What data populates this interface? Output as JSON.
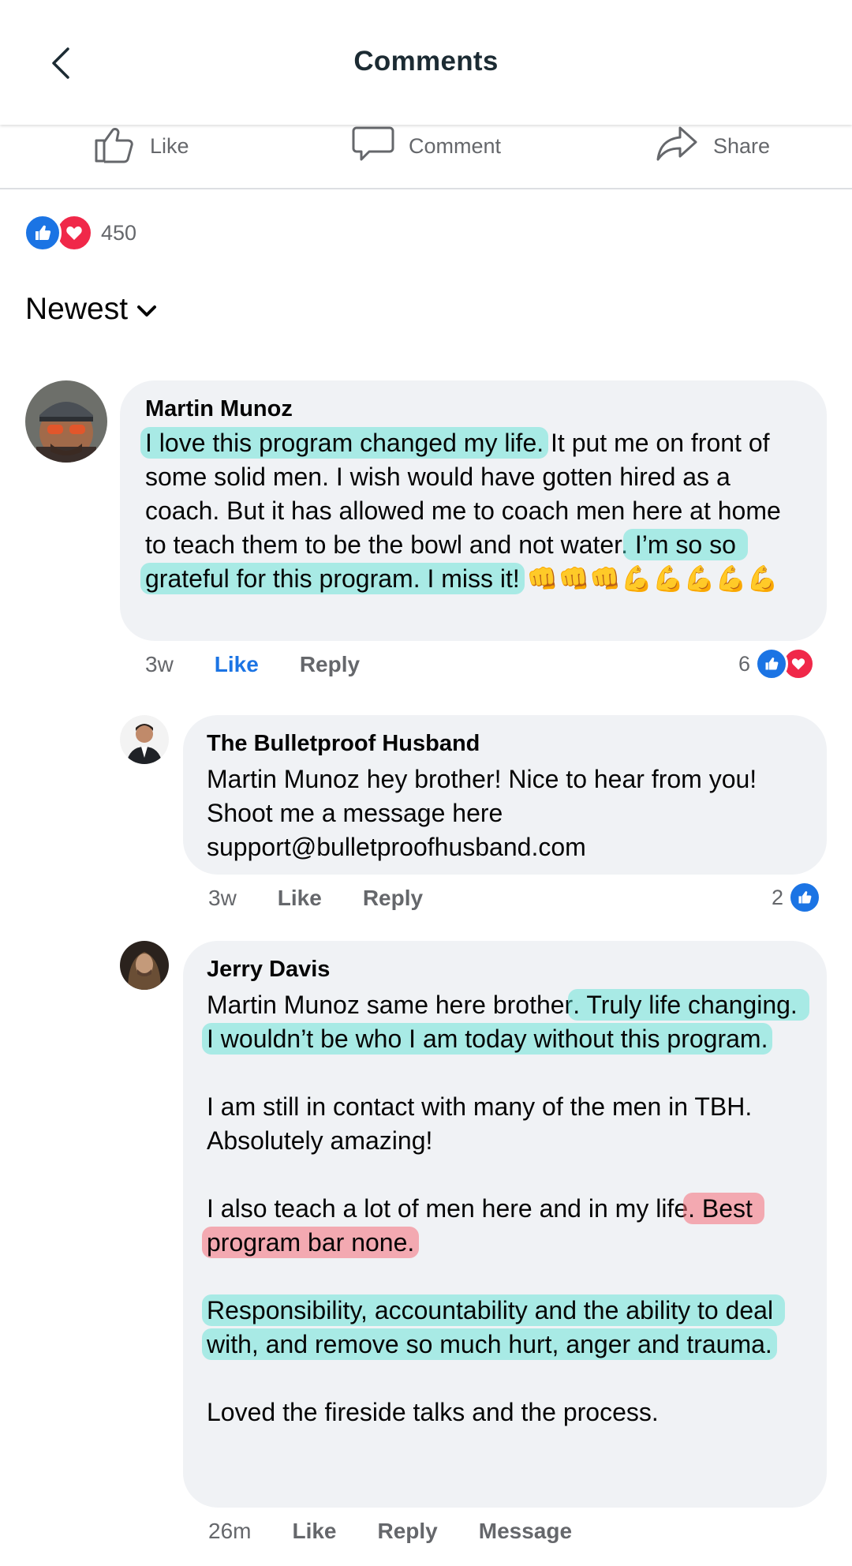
{
  "header": {
    "title": "Comments"
  },
  "actions": {
    "like": "Like",
    "comment": "Comment",
    "share": "Share"
  },
  "reactions": {
    "count": "450"
  },
  "sort": {
    "label": "Newest"
  },
  "colors": {
    "like_blue": "#1b74e4",
    "love_red": "#f02849",
    "highlight_teal": "#50e1d2",
    "highlight_red": "#f56e78",
    "bubble": "#f0f2f5"
  },
  "comments": [
    {
      "author": "Martin Munoz",
      "text": {
        "hl1": "I love this program changed my life.",
        "t2": " It put me on front of some solid men. I wish would have gotten hired as a coach. But it has allowed me to coach men here at home to teach them to be the bowl and not water.",
        "hl3": " I’m so so grateful for this program. I miss it!",
        "emoji": " 👊👊👊💪💪💪💪💪"
      },
      "time": "3w",
      "like": "Like",
      "reply": "Reply",
      "reaction_count": "6",
      "reaction_icons": [
        "like",
        "love"
      ]
    },
    {
      "author": "The Bulletproof Husband",
      "text": "Martin Munoz hey brother! Nice to hear from you! Shoot me a message here support@bulletproofhusband.com",
      "time": "3w",
      "like": "Like",
      "reply": "Reply",
      "reaction_count": "2",
      "reaction_icons": [
        "like"
      ]
    },
    {
      "author": "Jerry Davis",
      "text": {
        "p1a": "Martin Munoz same here brother",
        "p1hl": ". Truly life changing. I wouldn’t be who I am today without this program.",
        "p2": "I am still in contact with many of the men in TBH. Absolutely amazing!",
        "p3a": "I also teach a lot of men here and in my life",
        "p3hl": ". Best program bar none.",
        "p4hl": "Responsibility, accountability and the ability to deal with, and remove so much hurt, anger and trauma.",
        "p5": "Loved the fireside talks and the process."
      },
      "time": "26m",
      "like": "Like",
      "reply": "Reply",
      "message": "Message"
    }
  ]
}
